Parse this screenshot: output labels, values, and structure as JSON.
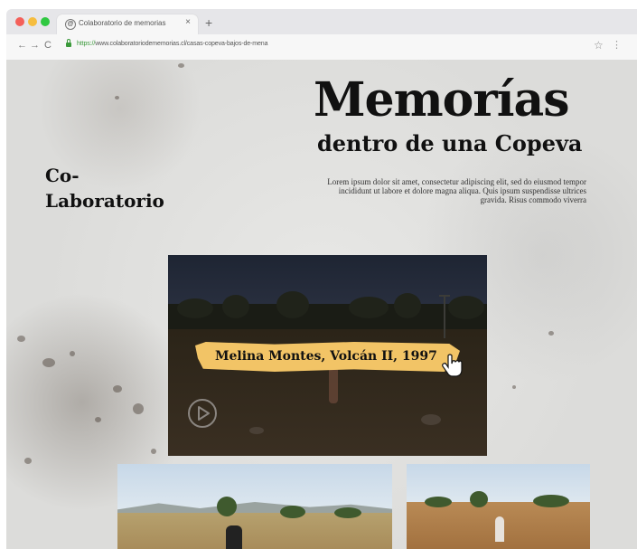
{
  "browser": {
    "tab_title": "Colaboratorio de memorias",
    "tab_close": "×",
    "new_tab": "+",
    "url_scheme": "https://",
    "url_rest": "www.colaboratoriodememorias.cl/casas-copeva-bajos-de-mena",
    "nav": {
      "back": "←",
      "forward": "→",
      "reload": "C"
    },
    "star": "☆",
    "ext": "⋮"
  },
  "page": {
    "title": "Memorías",
    "subtitle": "dentro de una Copeva",
    "description": "Lorem ipsum dolor sit amet, consectetur adipiscing elit, sed do eiusmod tempor incididunt ut labore et dolore magna aliqua. Quis ipsum suspendisse ultrices gravida. Risus commodo viverra",
    "brand_line1": "Co-",
    "brand_line2": "Laboratorio"
  },
  "hero": {
    "caption": "Melina Montes, Volcán II, 1997",
    "icons": [
      "pointer-hand-icon",
      "play-icon"
    ]
  },
  "colors": {
    "caption_bg": "#f2c466",
    "page_bg": "#dedede",
    "text": "#111111"
  }
}
